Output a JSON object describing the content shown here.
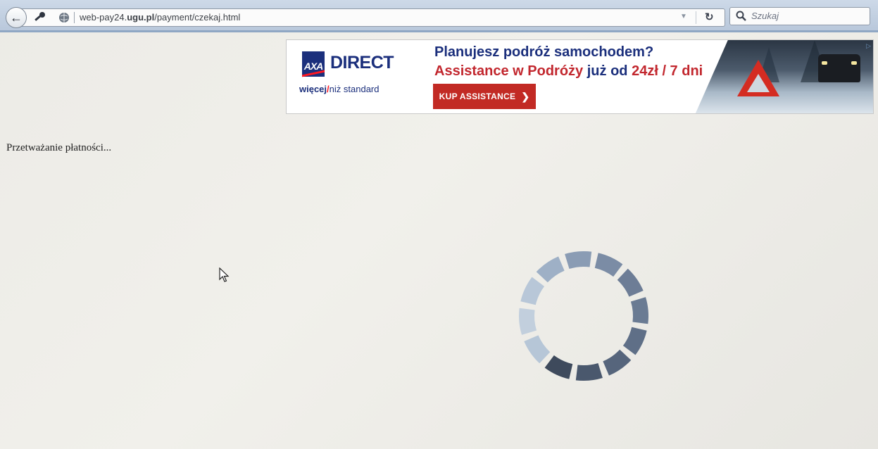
{
  "browser": {
    "url_prefix": "web-pay24.",
    "url_domain": "ugu.pl",
    "url_path": "/payment/czekaj.html",
    "search_placeholder": "Szukaj"
  },
  "banner": {
    "brand": "AXA",
    "brand_suffix": "DIRECT",
    "tagline_more": "więcej",
    "tagline_slash": "/",
    "tagline_standard": "niż standard",
    "headline": "Planujesz podróż samochodem?",
    "subline_red": "Assistance w Podróży",
    "subline_mid": " już od ",
    "subline_price": "24zł / 7 dni",
    "cta_label": "KUP ASSISTANCE",
    "cta_chevron": "❯",
    "colors": {
      "axa_blue": "#1b2f7c",
      "axa_red": "#c2272e"
    }
  },
  "page": {
    "status_text": "Przetważanie płatności..."
  },
  "spinner": {
    "segments": 12,
    "colors": [
      "#c2cfdd",
      "#b8c7d8",
      "#9eb0c6",
      "#8a9cb4",
      "#7b8ca5",
      "#6d7d96",
      "#6a7b93",
      "#5f6f87",
      "#56657c",
      "#4a586d",
      "#3e4a5c",
      "#b6c6d7"
    ]
  },
  "icons": {
    "back": "back-arrow-icon",
    "key": "key-icon",
    "globe": "globe-icon",
    "reload": "reload-icon",
    "search": "search-icon",
    "cursor": "mouse-cursor-icon",
    "warning": "warning-triangle-icon"
  }
}
